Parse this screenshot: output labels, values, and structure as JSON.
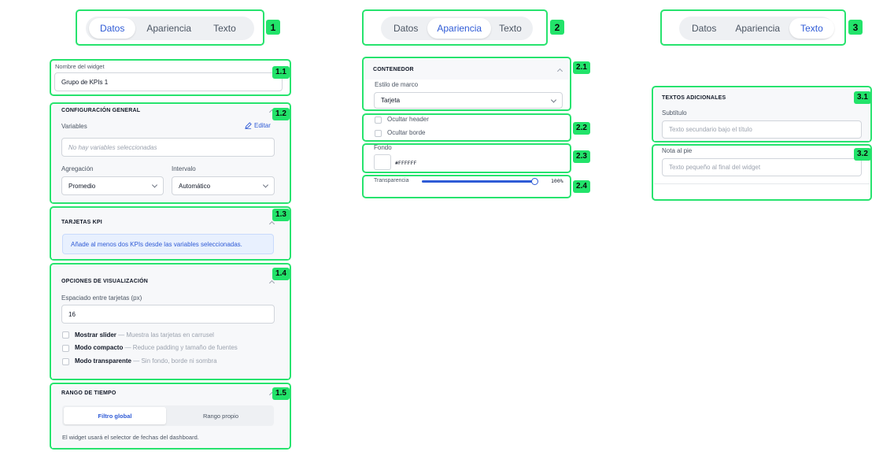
{
  "tabs": {
    "datos": "Datos",
    "apariencia": "Apariencia",
    "texto": "Texto"
  },
  "badges": {
    "b1": "1",
    "b2": "2",
    "b3": "3",
    "b1_1": "1.1",
    "b1_2": "1.2",
    "b1_3": "1.3",
    "b1_4": "1.4",
    "b1_5": "1.5",
    "b2_1": "2.1",
    "b2_2": "2.2",
    "b2_3": "2.3",
    "b2_4": "2.4",
    "b3_1": "3.1",
    "b3_2": "3.2"
  },
  "datos": {
    "widget_name_label": "Nombre del widget",
    "widget_name_value": "Grupo de KPIs 1",
    "general": {
      "title": "CONFIGURACIÓN GENERAL",
      "variables_label": "Variables",
      "edit_label": "Editar",
      "variables_empty": "No hay variables seleccionadas",
      "aggregation_label": "Agregación",
      "aggregation_value": "Promedio",
      "interval_label": "Intervalo",
      "interval_value": "Automático"
    },
    "kpi": {
      "title": "TARJETAS KPI",
      "notice": "Añade al menos dos KPIs desde las variables seleccionadas."
    },
    "display": {
      "title": "OPCIONES DE VISUALIZACIÓN",
      "spacing_label": "Espaciado entre tarjetas (px)",
      "spacing_value": "16",
      "options": [
        {
          "name": "Mostrar slider",
          "desc": " — Muestra las tarjetas en carrusel"
        },
        {
          "name": "Modo compacto",
          "desc": " — Reduce padding y tamaño de fuentes"
        },
        {
          "name": "Modo transparente",
          "desc": " — Sin fondo, borde ni sombra"
        }
      ]
    },
    "time": {
      "title": "RANGO DE TIEMPO",
      "global": "Filtro global",
      "own": "Rango propio",
      "note": "El widget usará el selector de fechas del dashboard."
    }
  },
  "apariencia": {
    "container_title": "CONTENEDOR",
    "frame_label": "Estilo de marco",
    "frame_value": "Tarjeta",
    "hide_header": "Ocultar header",
    "hide_border": "Ocultar borde",
    "background_label": "Fondo",
    "background_value": "#FFFFFF",
    "transparency_label": "Transparencia",
    "transparency_value": "100%",
    "transparency_fraction": 1.0
  },
  "texto": {
    "section_title": "TEXTOS ADICIONALES",
    "subtitle_label": "Subtítulo",
    "subtitle_placeholder": "Texto secundario bajo el título",
    "footer_label": "Nota al pie",
    "footer_placeholder": "Texto pequeño al final del widget"
  },
  "colors": {
    "accent": "#2f5bd6",
    "highlight": "#27e36e",
    "notice_bg": "#e8f0fe"
  }
}
